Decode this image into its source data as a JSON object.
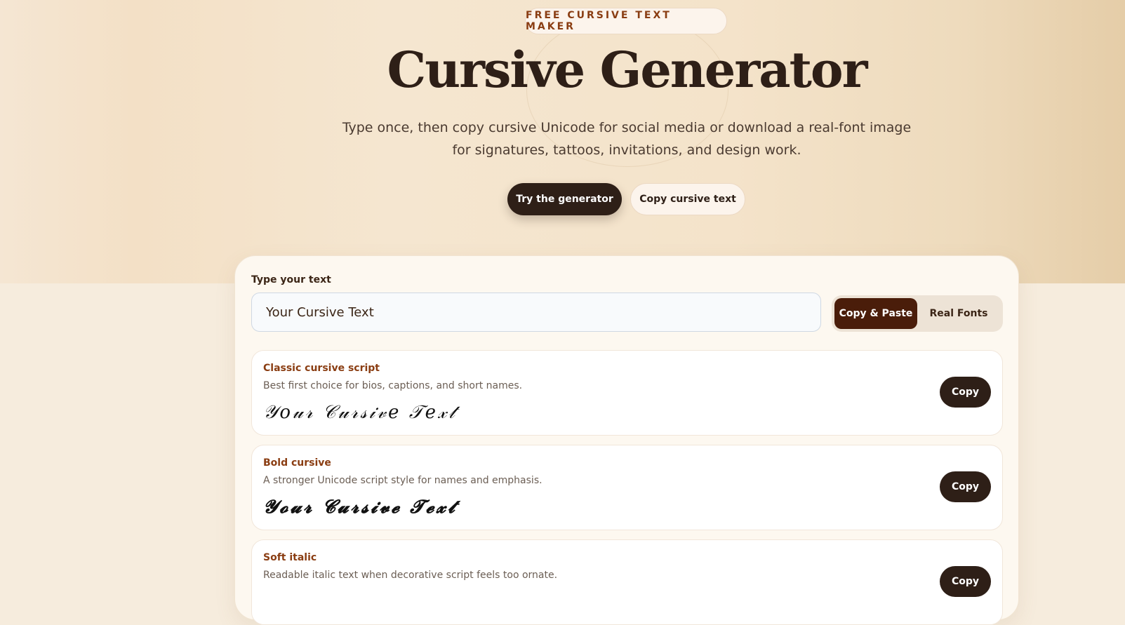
{
  "hero": {
    "badge": "FREE CURSIVE TEXT MAKER",
    "title": "Cursive Generator",
    "subtitle": "Type once, then copy cursive Unicode for social media or download a real-font image for signatures, tattoos, invitations, and design work.",
    "primary_button": "Try the generator",
    "secondary_button": "Copy cursive text"
  },
  "generator": {
    "input_label": "Type your text",
    "input_value": "Your Cursive Text",
    "modes": [
      {
        "label": "Copy & Paste",
        "active": true
      },
      {
        "label": "Real Fonts",
        "active": false
      }
    ]
  },
  "styles": [
    {
      "title": "Classic cursive script",
      "description": "Best first choice for bios, captions, and short names.",
      "preview": "𝒴𝑜𝓊𝓇 𝒞𝓊𝓇𝓈𝒾𝓋𝑒 𝒯𝑒𝓍𝓉",
      "copy_label": "Copy"
    },
    {
      "title": "Bold cursive",
      "description": "A stronger Unicode script style for names and emphasis.",
      "preview": "𝓨𝓸𝓾𝓻 𝓒𝓾𝓻𝓼𝓲𝓿𝓮 𝓣𝓮𝔁𝓽",
      "copy_label": "Copy"
    },
    {
      "title": "Soft italic",
      "description": "Readable italic text when decorative script feels too ornate.",
      "preview": "",
      "copy_label": "Copy"
    }
  ]
}
